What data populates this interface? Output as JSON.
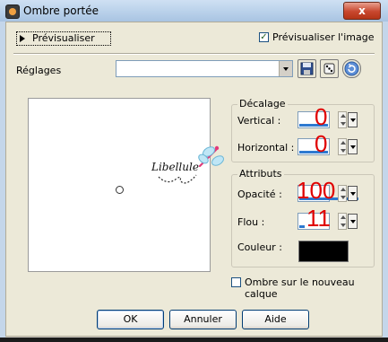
{
  "window": {
    "title": "Ombre portée",
    "close_label": "x"
  },
  "preview": {
    "toggle_label": "Prévisualiser",
    "checkbox_label": "Prévisualiser l'image",
    "checkbox_checked": true
  },
  "settings": {
    "label": "Réglages",
    "value": ""
  },
  "offset_group": {
    "title": "Décalage",
    "vertical_label": "Vertical :",
    "vertical_value": "0",
    "horizontal_label": "Horizontal :",
    "horizontal_value": "0"
  },
  "attributes_group": {
    "title": "Attributs",
    "opacity_label": "Opacité :",
    "opacity_value": "100",
    "blur_label": "Flou :",
    "blur_value": "11",
    "color_label": "Couleur :",
    "color": "#000000"
  },
  "new_layer": {
    "label": "Ombre sur le nouveau calque",
    "checked": false
  },
  "watermark": {
    "text": "Libellule"
  },
  "buttons": {
    "ok": "OK",
    "cancel": "Annuler",
    "help": "Aide"
  },
  "icons": [
    "save-icon",
    "dice-icon",
    "reset-icon",
    "close-icon"
  ]
}
